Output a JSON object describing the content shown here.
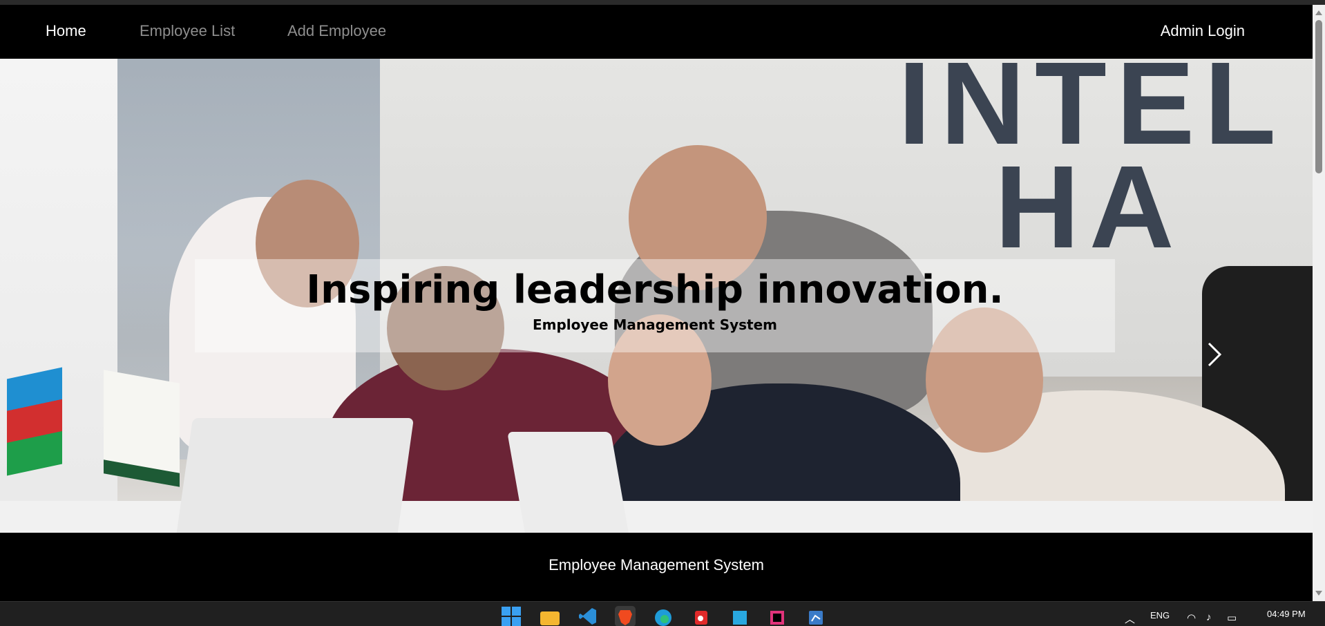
{
  "nav": {
    "home": "Home",
    "employee_list": "Employee List",
    "add_employee": "Add Employee",
    "admin_login": "Admin Login"
  },
  "hero": {
    "title": "Inspiring leadership innovation.",
    "subtitle": "Employee Management System",
    "wall_letters_line1": "INTEL",
    "wall_letters_line2": "HA"
  },
  "footer": {
    "text": "Employee Management System"
  },
  "taskbar": {
    "language": "ENG",
    "time": "04:49 PM",
    "icons": [
      "windows-start-icon",
      "file-explorer-icon",
      "vscode-icon",
      "brave-browser-icon",
      "edge-browser-icon",
      "app-icon",
      "app-icon",
      "intellij-idea-icon",
      "app-icon"
    ]
  },
  "colors": {
    "nav_background": "#000000",
    "nav_active": "#ffffff",
    "nav_inactive": "#8e8e8e",
    "footer_background": "#000000"
  }
}
